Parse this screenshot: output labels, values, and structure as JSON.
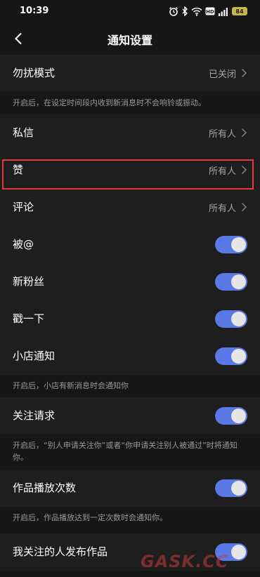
{
  "status_bar": {
    "time": "10:39",
    "battery": "84",
    "icons": [
      "alarm-icon",
      "bluetooth-icon",
      "wifi-icon",
      "hd-icon",
      "signal-icon",
      "battery-icon"
    ]
  },
  "header": {
    "title": "通知设置",
    "back_icon": "chevron-left-icon"
  },
  "settings": {
    "dnd": {
      "label": "勿扰模式",
      "value": "已关闭"
    },
    "dnd_note": "开启后，在设定时间段内收到新消息时不会响铃或振动。",
    "private_message": {
      "label": "私信",
      "value": "所有人"
    },
    "likes": {
      "label": "赞",
      "value": "所有人"
    },
    "comments": {
      "label": "评论",
      "value": "所有人"
    },
    "mention": {
      "label": "被@",
      "enabled": true
    },
    "new_fans": {
      "label": "新粉丝",
      "enabled": true
    },
    "poke": {
      "label": "戳一下",
      "enabled": true
    },
    "shop": {
      "label": "小店通知",
      "enabled": true
    },
    "shop_note": "开启后，小店有新消息时会通知你",
    "follow_request": {
      "label": "关注请求",
      "enabled": true
    },
    "follow_request_note": "开启后，“别人申请关注你”或者“你申请关注别人被通过”时将通知你。",
    "play_count": {
      "label": "作品播放次数",
      "enabled": true
    },
    "play_count_note": "开启后，作品播放达到一定次数时会通知你。",
    "following_posts": {
      "label": "我关注的人发布作品",
      "enabled": true
    }
  },
  "colors": {
    "background": "#161616",
    "row_background": "#1e1e1e",
    "toggle_on": "#5a78e6",
    "highlight": "#e23a3a"
  },
  "watermark": "GASK.CC"
}
